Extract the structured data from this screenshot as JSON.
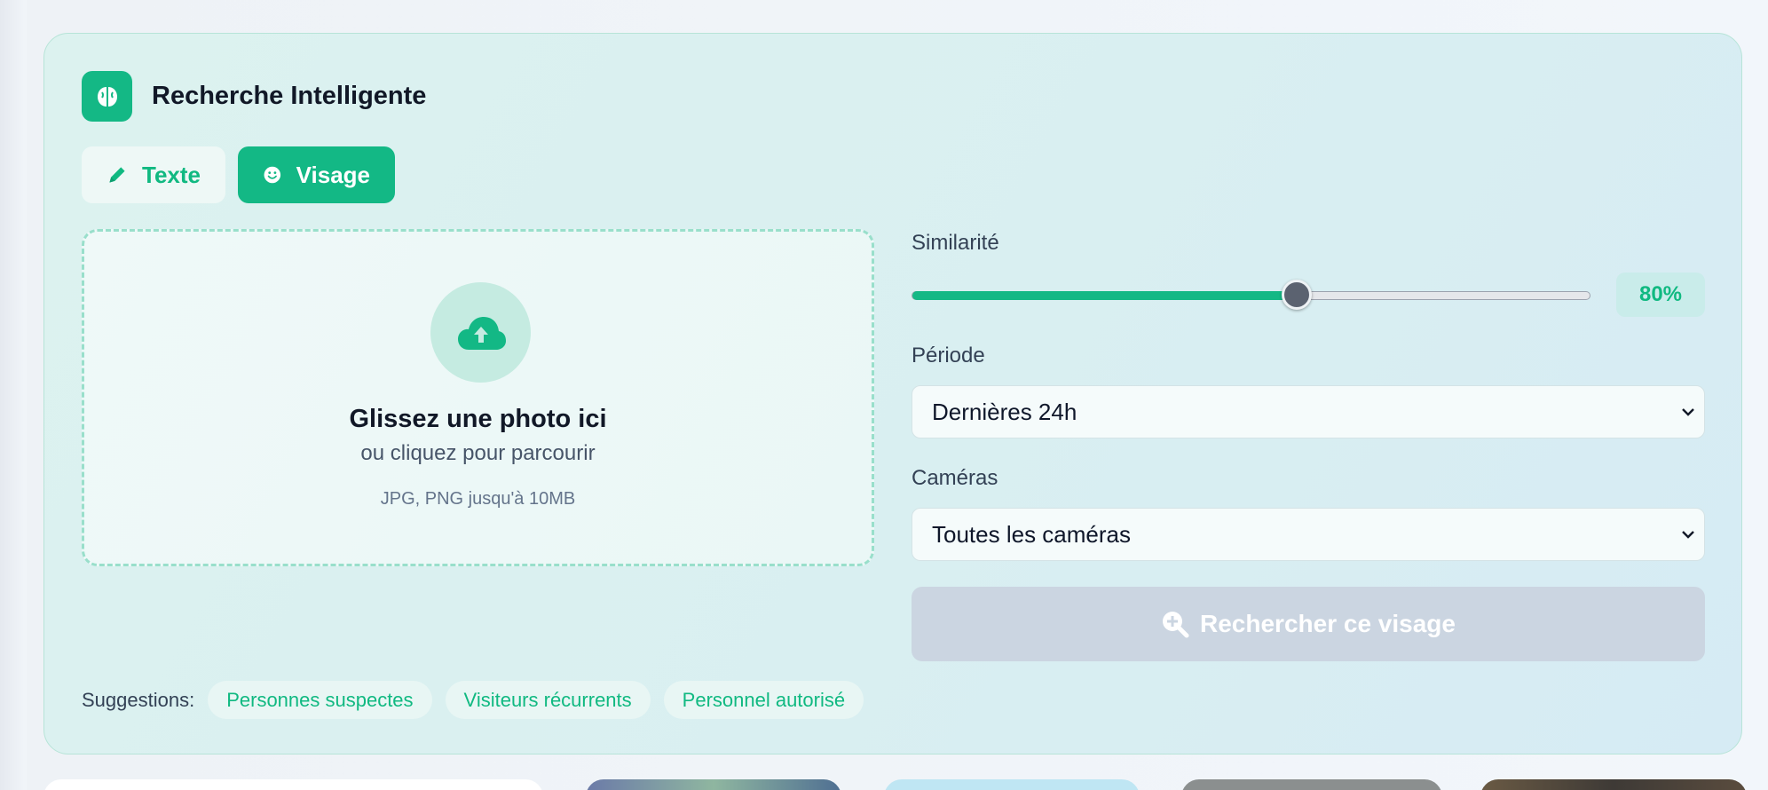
{
  "panel": {
    "title": "Recherche Intelligente",
    "icon": "brain-icon"
  },
  "tabs": [
    {
      "label": "Texte",
      "icon": "pencil-icon",
      "active": false
    },
    {
      "label": "Visage",
      "icon": "smile-icon",
      "active": true
    }
  ],
  "upload": {
    "icon": "cloud-upload-icon",
    "title": "Glissez une photo ici",
    "subtitle": "ou cliquez pour parcourir",
    "hint": "JPG, PNG jusqu'à 10MB"
  },
  "similarity": {
    "label": "Similarité",
    "value_label": "80%",
    "slider_fraction": 0.567
  },
  "period": {
    "label": "Période",
    "selected": "Dernières 24h"
  },
  "cameras": {
    "label": "Caméras",
    "selected": "Toutes les caméras"
  },
  "search_button": {
    "label": "Rechercher ce visage",
    "icon": "search-plus-icon",
    "disabled": true
  },
  "suggestions": {
    "label": "Suggestions:",
    "items": [
      "Personnes suspectes",
      "Visiteurs récurrents",
      "Personnel autorisé"
    ]
  },
  "colors": {
    "accent": "#14b885",
    "disabled": "#cbd5e1"
  }
}
